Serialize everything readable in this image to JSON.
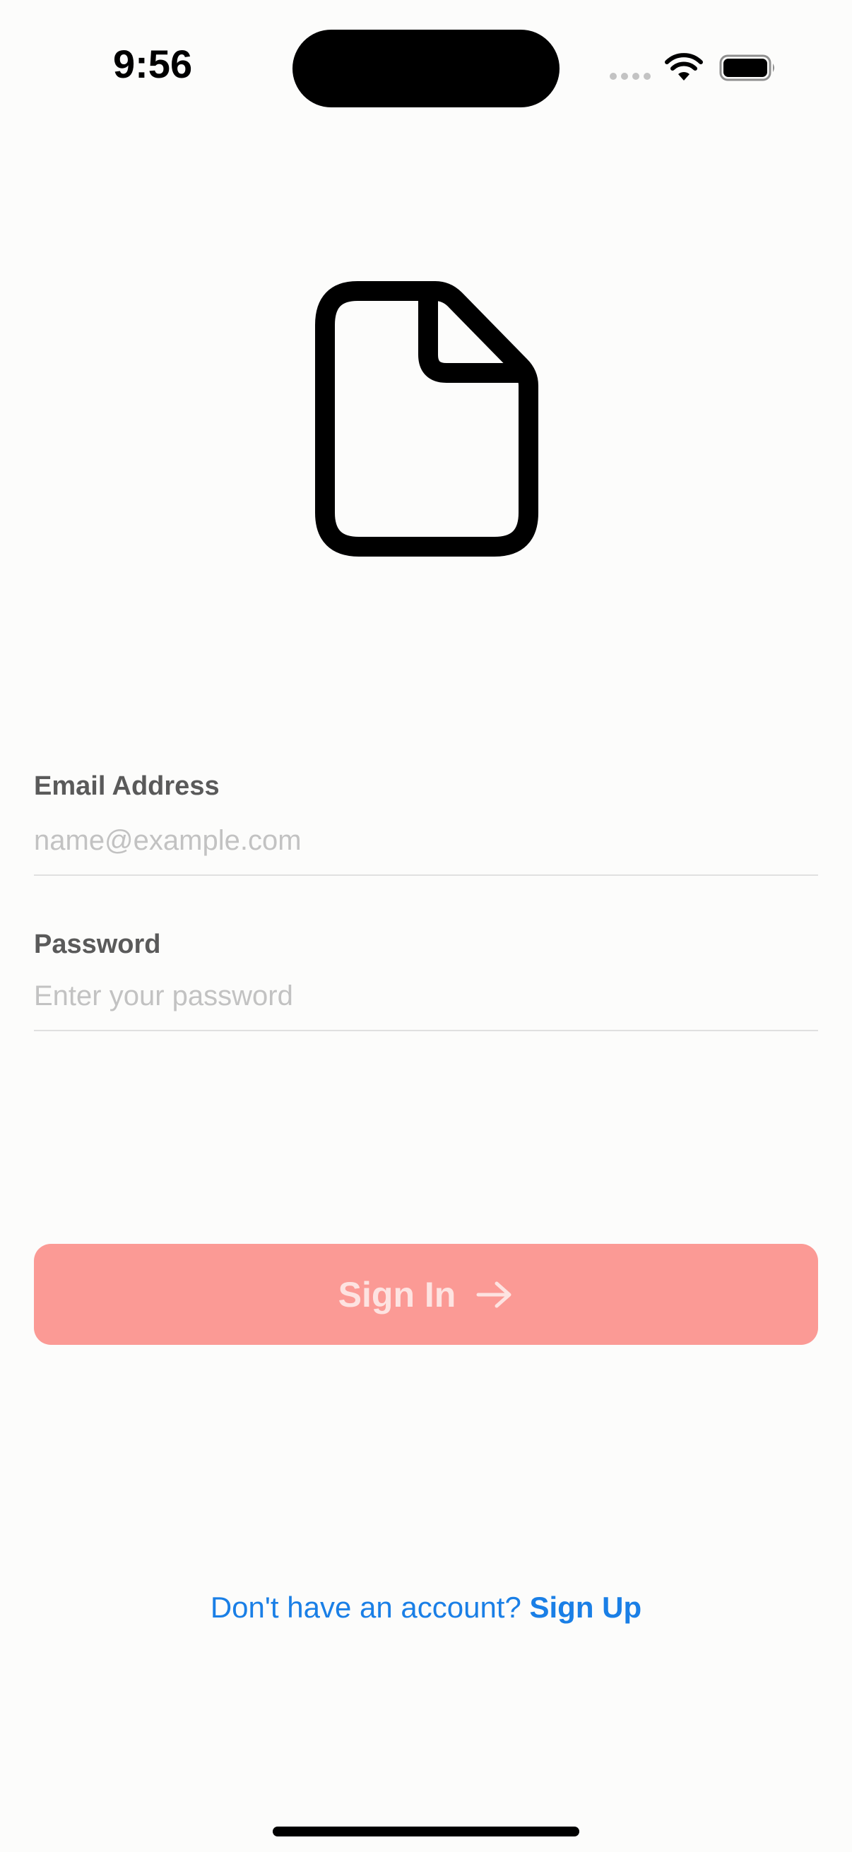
{
  "status_bar": {
    "time": "9:56",
    "icons": [
      "signal-dots-icon",
      "wifi-icon",
      "battery-icon"
    ]
  },
  "logo": {
    "icon": "document-icon"
  },
  "form": {
    "email": {
      "label": "Email Address",
      "placeholder": "name@example.com",
      "value": ""
    },
    "password": {
      "label": "Password",
      "placeholder": "Enter your password",
      "value": ""
    }
  },
  "signin_button": {
    "label": "Sign In",
    "icon": "arrow-right-icon",
    "color": "#fb9a95",
    "text_color": "#fde3e1"
  },
  "signup": {
    "prompt": "Don't have an account?",
    "link_label": "Sign Up",
    "color": "#1a7fe6"
  }
}
